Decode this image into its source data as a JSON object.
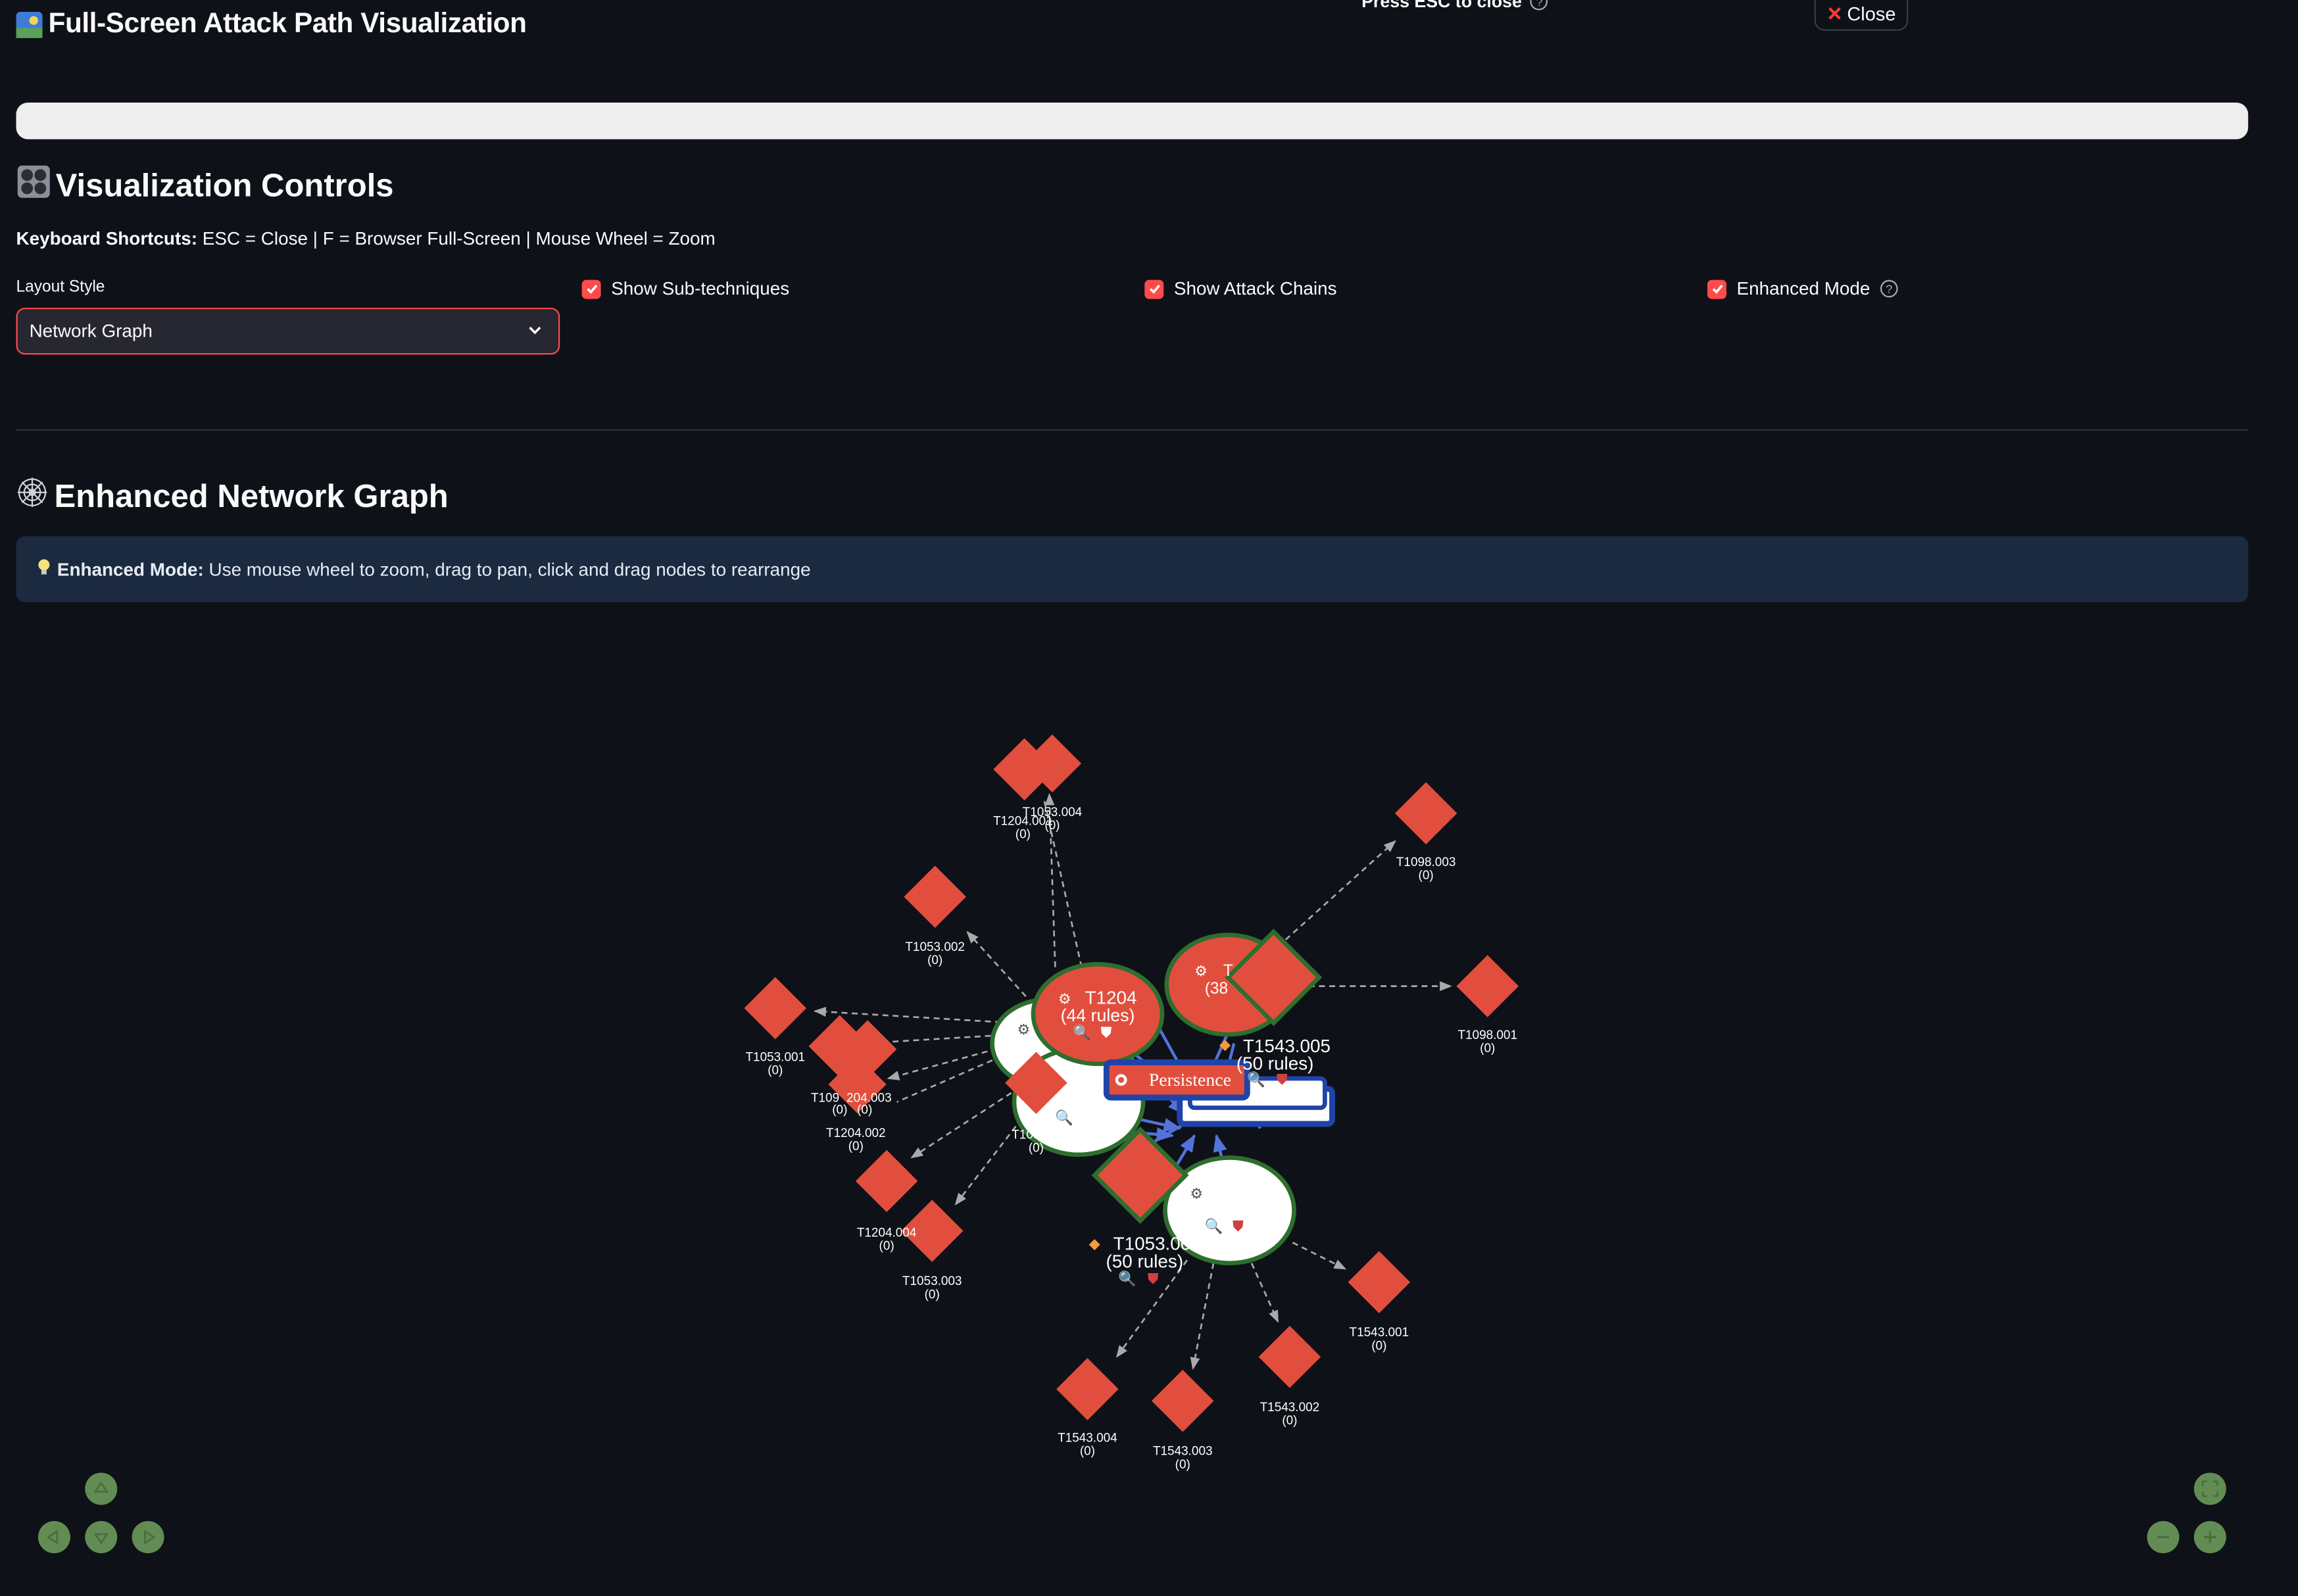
{
  "header": {
    "title": "Full-Screen Attack Path Visualization",
    "esc_hint": "Press ESC to close",
    "close_label": "Close"
  },
  "controls": {
    "heading": "Visualization Controls",
    "shortcuts_label": "Keyboard Shortcuts:",
    "shortcuts_text": "ESC = Close | F = Browser Full-Screen | Mouse Wheel = Zoom",
    "layout_label": "Layout Style",
    "layout_value": "Network Graph",
    "show_subtechniques": {
      "label": "Show Sub-techniques",
      "checked": true
    },
    "show_attack_chains": {
      "label": "Show Attack Chains",
      "checked": true
    },
    "enhanced_mode": {
      "label": "Enhanced Mode",
      "checked": true
    }
  },
  "graph_section": {
    "heading": "Enhanced Network Graph",
    "info_label": "Enhanced Mode:",
    "info_text": "Use mouse wheel to zoom, drag to pan, click and drag nodes to rearrange"
  },
  "graph": {
    "tactic_label": "Persistence",
    "nodes": {
      "t1204": {
        "id": "T1204",
        "rules": "(44 rules)"
      },
      "t1543_005": {
        "id": "T1543.005",
        "rules": "(50 rules)"
      },
      "t1053_00x": {
        "id": "T1053.00",
        "rules": "(50 rules)"
      },
      "t_partial": {
        "id": "T",
        "rules": "(38"
      }
    },
    "subnodes": [
      {
        "id": "T1204.001",
        "count": "(0)"
      },
      {
        "id": "T1053.004",
        "count": "(0)"
      },
      {
        "id": "T1098.003",
        "count": "(0)"
      },
      {
        "id": "T1053.002",
        "count": "(0)"
      },
      {
        "id": "T1098.001",
        "count": "(0)"
      },
      {
        "id": "T1053.001",
        "count": "(0)"
      },
      {
        "id": "T109",
        "count": "(0)"
      },
      {
        "id": "204.003",
        "count": "(0)"
      },
      {
        "id": "T1204.002",
        "count": "(0)"
      },
      {
        "id": "T109",
        "count": "(0)"
      },
      {
        "id": "T1204.004",
        "count": "(0)"
      },
      {
        "id": "T1053.003",
        "count": "(0)"
      },
      {
        "id": "T1543.001",
        "count": "(0)"
      },
      {
        "id": "T1543.004",
        "count": "(0)"
      },
      {
        "id": "T1543.003",
        "count": "(0)"
      },
      {
        "id": "T1543.002",
        "count": "(0)"
      }
    ],
    "colors": {
      "technique": "#e24e3e",
      "border": "#2e6e2e",
      "edge": "#aaaaaa",
      "highlight": "#5b7ff0"
    }
  }
}
